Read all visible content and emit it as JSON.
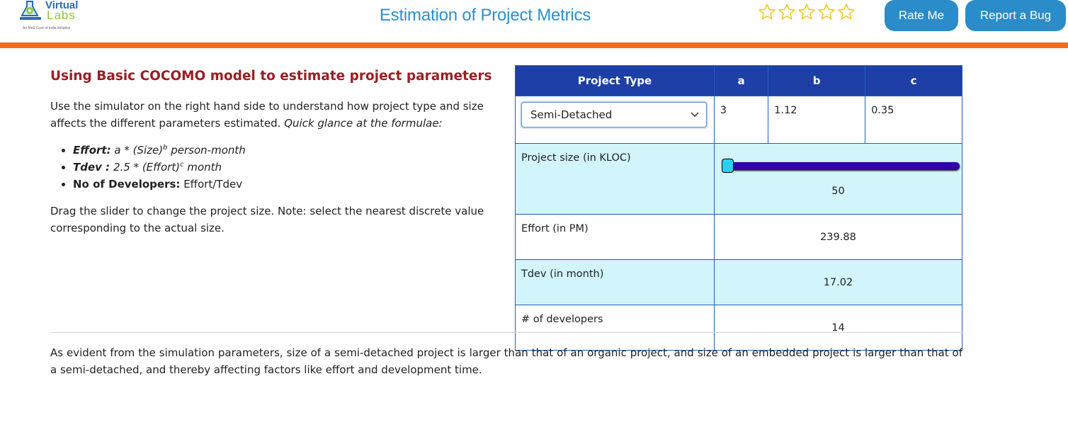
{
  "header": {
    "logo": {
      "line1": "Virtual",
      "line2": "Labs",
      "tagline": "An MoE Govt of India Initiative"
    },
    "title": "Estimation of Project Metrics",
    "rating": {
      "stars_total": 5,
      "stars_filled": 0,
      "star_color": "#f5c518"
    },
    "rate_button": "Rate Me",
    "bug_button": "Report a Bug"
  },
  "colors": {
    "accent_bar": "#f36b1c",
    "title": "#2c8fcf",
    "button": "#2a8cc8",
    "heading": "#9b1e24",
    "table_header": "#1d3fa6",
    "row_highlight": "#d2f4fb",
    "slider_track": "#3100a8",
    "slider_thumb": "#2bd0f0"
  },
  "content": {
    "heading": "Using Basic COCOMO model to estimate project parameters",
    "intro": "Use the simulator on the right hand side to understand how project type and size affects the different parameters estimated.",
    "intro_em": "Quick glance at the formulae:",
    "formulae": {
      "effort_label": "Effort:",
      "effort_expr": "a * (Size)",
      "effort_sup": "b",
      "effort_unit": "person-month",
      "tdev_label": "Tdev :",
      "tdev_expr": "2.5 * (Effort)",
      "tdev_sup": "c",
      "tdev_unit": "month",
      "dev_label": "No of Developers:",
      "dev_expr": "Effort/Tdev"
    },
    "drag_note": "Drag the slider to change the project size. Note: select the nearest discrete value corresponding to the actual size."
  },
  "table": {
    "headers": {
      "type": "Project Type",
      "a": "a",
      "b": "b",
      "c": "c"
    },
    "project_type_selected": "Semi-Detached",
    "a": "3",
    "b": "1.12",
    "c": "0.35",
    "size_label": "Project size (in KLOC)",
    "size_value": "50",
    "size_slider_fraction": 0.0,
    "effort_label": "Effort (in PM)",
    "effort_value": "239.88",
    "tdev_label": "Tdev (in month)",
    "tdev_value": "17.02",
    "dev_label": "# of developers",
    "dev_value": "14"
  },
  "footer": {
    "conclusion": "As evident from the simulation parameters, size of a semi-detached project is larger than that of an organic project, and size of an embedded project is larger than that of a semi-detached, and thereby affecting factors like effort and development time."
  }
}
